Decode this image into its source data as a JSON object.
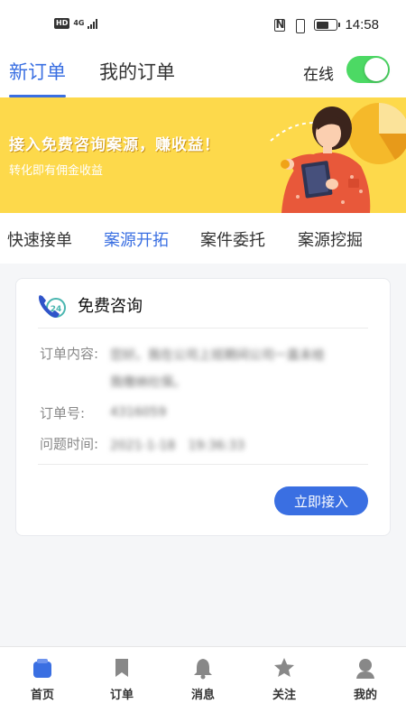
{
  "status_bar": {
    "hd": "HD",
    "network": "4G",
    "nfc": "N",
    "time": "14:58"
  },
  "header": {
    "tabs": [
      {
        "label": "新订单",
        "active": true
      },
      {
        "label": "我的订单",
        "active": false
      }
    ],
    "online_label": "在线",
    "online_toggle_on": true,
    "accent_color": "#3a6fe2",
    "toggle_color": "#4cd964"
  },
  "banner": {
    "headline": "接入免费咨询案源，赚收益！",
    "subtext": "转化即有佣金收益",
    "background": "#fdd94b"
  },
  "category_tabs": [
    {
      "label": "快速接单",
      "active": false
    },
    {
      "label": "案源开拓",
      "active": true
    },
    {
      "label": "案件委托",
      "active": false
    },
    {
      "label": "案源挖掘",
      "active": false
    }
  ],
  "order_card": {
    "badge": "24",
    "title": "免费咨询",
    "content_label": "订单内容:",
    "content_line1": "您好。我在公司上班期间公司一直未给",
    "content_line2": "我缴纳社保。",
    "order_no_label": "订单号:",
    "order_no": "4316059",
    "time_label": "问题时间:",
    "time": "2021-1-18　19:36:33",
    "accept_button": "立即接入"
  },
  "bottom_nav": [
    {
      "label": "首页",
      "icon": "home-icon",
      "active": true
    },
    {
      "label": "订单",
      "icon": "bookmark-icon",
      "active": false
    },
    {
      "label": "消息",
      "icon": "bell-icon",
      "active": false
    },
    {
      "label": "关注",
      "icon": "star-icon",
      "active": false
    },
    {
      "label": "我的",
      "icon": "user-icon",
      "active": false
    }
  ]
}
